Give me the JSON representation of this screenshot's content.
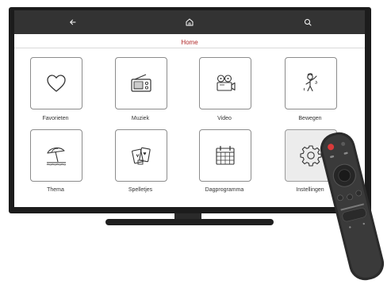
{
  "header": {
    "back_icon": "arrow-left-icon",
    "home_icon": "home-icon",
    "search_icon": "search-icon",
    "title": "Home"
  },
  "tiles": [
    {
      "label": "Favorieten",
      "icon": "heart-icon"
    },
    {
      "label": "Muziek",
      "icon": "radio-icon"
    },
    {
      "label": "Video",
      "icon": "film-camera-icon"
    },
    {
      "label": "Bewegen",
      "icon": "person-exercise-icon"
    },
    {
      "label": "Thema",
      "icon": "beach-umbrella-icon"
    },
    {
      "label": "Spelletjes",
      "icon": "playing-cards-icon"
    },
    {
      "label": "Dagprogramma",
      "icon": "calendar-icon"
    },
    {
      "label": "Instellingen",
      "icon": "gear-icon"
    }
  ],
  "selected_tile": "Instellingen",
  "colors": {
    "topbar": "#333333",
    "title_text": "#b02a2a",
    "tv_frame": "#1c1c1c",
    "remote_accent": "#d93a3a"
  }
}
